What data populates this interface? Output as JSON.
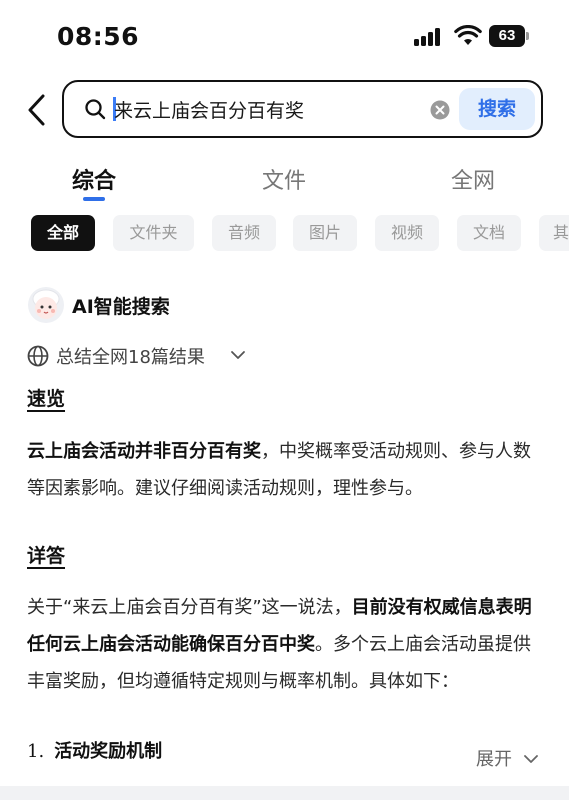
{
  "status_bar": {
    "time": "08:56",
    "battery": "63"
  },
  "search": {
    "query": "来云上庙会百分百有奖",
    "button_label": "搜索"
  },
  "tabs": [
    {
      "label": "综合",
      "active": true
    },
    {
      "label": "文件",
      "active": false
    },
    {
      "label": "全网",
      "active": false
    }
  ],
  "chips": [
    {
      "label": "全部",
      "active": true
    },
    {
      "label": "文件夹",
      "active": false
    },
    {
      "label": "音频",
      "active": false
    },
    {
      "label": "图片",
      "active": false
    },
    {
      "label": "视频",
      "active": false
    },
    {
      "label": "文档",
      "active": false
    },
    {
      "label": "其",
      "active": false
    }
  ],
  "ai": {
    "title": "AI智能搜索",
    "summary": "总结全网18篇结果",
    "overview_heading": "速览",
    "overview_bold": "云上庙会活动并非百分百有奖",
    "overview_rest": "，中奖概率受活动规则、参与人数等因素影响。建议仔细阅读活动规则，理性参与。",
    "detail_heading": "详答",
    "detail_part1": "关于“来云上庙会百分百有奖”这一说法，",
    "detail_bold": "目前没有权威信息表明任何云上庙会活动能确保百分百中奖",
    "detail_part2": "。多个云上庙会活动虽提供丰富奖励，但均遵循特定规则与概率机制。具体如下：",
    "list_number": "1.",
    "list_item": "活动奖励机制",
    "expand_label": "展开"
  },
  "colors": {
    "accent": "#2f6fe8",
    "search_button_bg": "#e2eefd",
    "chip_bg": "#f2f3f5"
  },
  "icons": [
    "back-arrow-icon",
    "search-icon",
    "clear-icon",
    "avatar-icon",
    "globe-icon",
    "chevron-down-icon",
    "signal-icon",
    "wifi-icon",
    "battery-icon"
  ]
}
